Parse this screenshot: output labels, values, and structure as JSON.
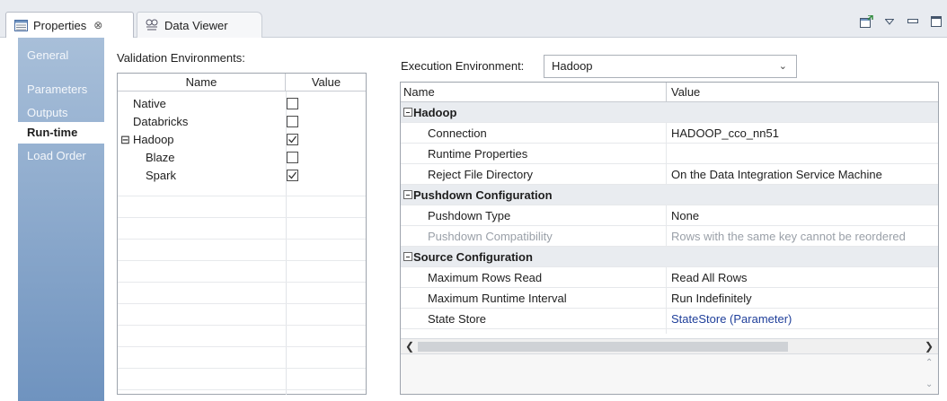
{
  "tabs": [
    {
      "label": "Properties",
      "close": "⊗"
    },
    {
      "label": "Data Viewer"
    }
  ],
  "nav": {
    "items": [
      {
        "label": "General"
      },
      {
        "label": "Parameters"
      },
      {
        "label": "Outputs"
      },
      {
        "label": "Run-time"
      },
      {
        "label": "Load Order"
      }
    ],
    "selected": "Run-time"
  },
  "validation": {
    "label": "Validation Environments:",
    "columns": [
      "Name",
      "Value"
    ],
    "rows": [
      {
        "name": "Native",
        "checked": false,
        "indent": 1
      },
      {
        "name": "Databricks",
        "checked": false,
        "indent": 1
      },
      {
        "name": "Hadoop",
        "checked": true,
        "indent": 0,
        "expander": "⊟"
      },
      {
        "name": "Blaze",
        "checked": false,
        "indent": 2
      },
      {
        "name": "Spark",
        "checked": true,
        "indent": 2
      }
    ]
  },
  "execution": {
    "label": "Execution Environment:",
    "value": "Hadoop"
  },
  "properties": {
    "columns": [
      "Name",
      "Value"
    ],
    "groups": [
      {
        "name": "Hadoop",
        "rows": [
          {
            "name": "Connection",
            "value": "HADOOP_cco_nn51"
          },
          {
            "name": "Runtime Properties",
            "value": ""
          },
          {
            "name": "Reject File Directory",
            "value": "On the Data Integration Service Machine"
          }
        ]
      },
      {
        "name": "Pushdown Configuration",
        "rows": [
          {
            "name": "Pushdown Type",
            "value": "None"
          },
          {
            "name": "Pushdown Compatibility",
            "value": "Rows with the same key cannot be reordered",
            "disabled": true
          }
        ]
      },
      {
        "name": "Source Configuration",
        "rows": [
          {
            "name": "Maximum Rows Read",
            "value": "Read All Rows"
          },
          {
            "name": "Maximum Runtime Interval",
            "value": "Run Indefinitely"
          },
          {
            "name": "State Store",
            "value": "StateStore (Parameter)",
            "link": true
          }
        ]
      }
    ]
  }
}
